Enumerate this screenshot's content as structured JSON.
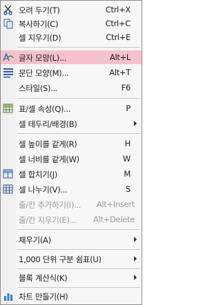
{
  "items": [
    {
      "label": "오려 두기(T)",
      "shortcut": "Ctrl+X",
      "icon": "scissors-icon"
    },
    {
      "label": "복사하기(C)",
      "shortcut": "Ctrl+C",
      "icon": "copy-icon"
    },
    {
      "label": "셀 지우기(D)",
      "shortcut": "Ctrl+E"
    },
    {
      "label": "글자 모양(L)...",
      "shortcut": "Alt+L",
      "icon": "font-icon"
    },
    {
      "label": "문단 모양(M)...",
      "shortcut": "Alt+T",
      "icon": "paragraph-icon"
    },
    {
      "label": "스타일(S)...",
      "shortcut": "F6"
    },
    {
      "label": "표/셀 속성(Q)...",
      "shortcut": "P",
      "icon": "table-props-icon"
    },
    {
      "label": "셀 테두리/배경(B)"
    },
    {
      "label": "셀 높이를 같게(R)",
      "shortcut": "H"
    },
    {
      "label": "셀 너비를 같게(W)",
      "shortcut": "W"
    },
    {
      "label": "셀 합치기(J)",
      "shortcut": "M",
      "icon": "merge-cells-icon"
    },
    {
      "label": "셀 나누기(V)...",
      "shortcut": "S",
      "icon": "split-cells-icon"
    },
    {
      "label": "줄/칸 추가하기(I)...",
      "shortcut": "Alt+Insert"
    },
    {
      "label": "줄/칸 지우기(E)...",
      "shortcut": "Alt+Delete"
    },
    {
      "label": "채우기(A)"
    },
    {
      "label": "1,000 단위 구분 쉼표(U)"
    },
    {
      "label": "블록 계산식(K)"
    },
    {
      "label": "차트 만들기(H)",
      "icon": "chart-icon"
    }
  ],
  "colors": {
    "highlight": "#f6c1cc",
    "disabled": "#9a9a9a"
  }
}
